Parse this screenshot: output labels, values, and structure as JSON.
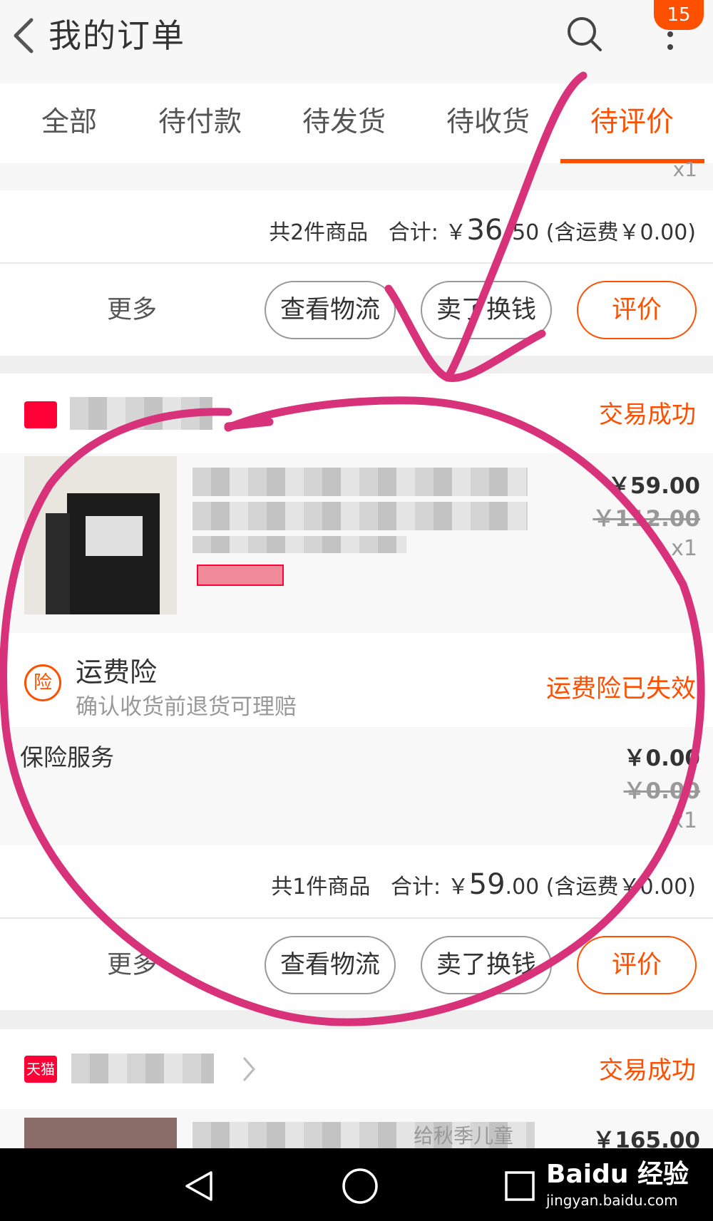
{
  "header": {
    "title": "我的订单",
    "notification_count": "15"
  },
  "tabs": [
    "全部",
    "待付款",
    "待发货",
    "待收货",
    "待评价"
  ],
  "colors": {
    "accent": "#ff5000",
    "tmall": "#ff0036",
    "annotation": "#d8337a"
  },
  "order1": {
    "top_qty": "x1",
    "summary_count": "共2件商品",
    "summary_total_label": "合计: ￥",
    "summary_total_int": "36.",
    "summary_total_dec": "50",
    "summary_shipping": " (含运费￥0.00)",
    "more": "更多",
    "btn_logistics": "查看物流",
    "btn_sell": "卖了换钱",
    "btn_review": "评价"
  },
  "order2": {
    "status": "交易成功",
    "price": "￥59.00",
    "original_price": "￥112.00",
    "qty": "x1",
    "insurance_icon": "险",
    "insurance_title": "运费险",
    "insurance_sub": "确认收货前退货可理赔",
    "insurance_status": "运费险已失效",
    "service_label": "保险服务",
    "service_price": "￥0.00",
    "service_original_price": "￥0.00",
    "service_qty": "x1",
    "summary_count": "共1件商品",
    "summary_total_label": "合计: ￥",
    "summary_total_int": "59",
    "summary_total_dec": ".00",
    "summary_shipping": " (含运费￥0.00)",
    "more": "更多",
    "btn_logistics": "查看物流",
    "btn_sell": "卖了换钱",
    "btn_review": "评价"
  },
  "order3": {
    "shop_logo": "天猫",
    "status": "交易成功",
    "title_fragment": "给秋季儿童",
    "price": "￥165.00"
  },
  "watermark": {
    "brand": "Baidu 经验",
    "url": "jingyan.baidu.com"
  }
}
